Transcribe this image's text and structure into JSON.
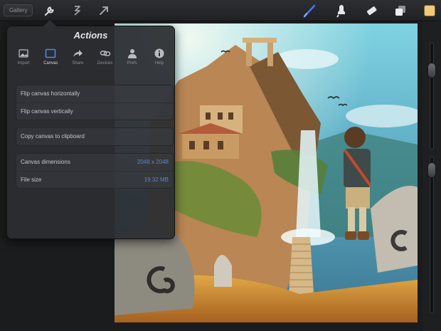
{
  "toolbar": {
    "gallery_label": "Gallery",
    "left_icons": [
      "wrench-icon",
      "adjust-icon",
      "transform-icon"
    ],
    "right_icons": [
      "brush-icon",
      "smudge-icon",
      "eraser-icon",
      "layers-icon",
      "color-swatch-icon"
    ],
    "active_color": "#f2c87a",
    "brush_color": "#3e7bea"
  },
  "actions": {
    "title": "Actions",
    "tabs": [
      {
        "label": "Import",
        "icon": "image-icon",
        "active": false
      },
      {
        "label": "Canvas",
        "icon": "canvas-icon",
        "active": true
      },
      {
        "label": "Share",
        "icon": "share-arrow-icon",
        "active": false
      },
      {
        "label": "Devices",
        "icon": "link-icon",
        "active": false
      },
      {
        "label": "Prefs",
        "icon": "person-icon",
        "active": false
      },
      {
        "label": "Help",
        "icon": "info-icon",
        "active": false
      }
    ],
    "flip_group": [
      "Flip canvas horizontally",
      "Flip canvas vertically"
    ],
    "copy_label": "Copy canvas to clipboard",
    "info": [
      {
        "label": "Canvas dimensions",
        "value": "2048 x 2048"
      },
      {
        "label": "File size",
        "value": "19.32 MB"
      }
    ]
  }
}
